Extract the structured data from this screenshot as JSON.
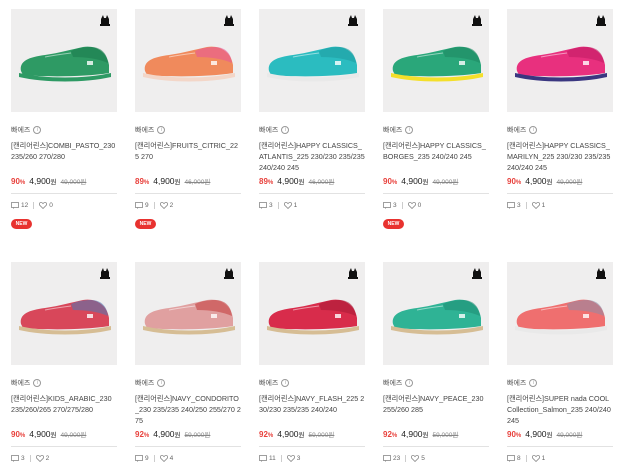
{
  "products": [
    {
      "brand": "빠에즈",
      "title": "[캔리어린스]COMBI_PASTO_230 235/260 270/280",
      "rate": "90",
      "price": "4,900",
      "orig": "49,000원",
      "comments": "12",
      "likes": "0",
      "badge": "NEW",
      "colors": {
        "upper": "#2e9a64",
        "sole": "#2e9a64",
        "trim": "#1c7a4d"
      }
    },
    {
      "brand": "빠에즈",
      "title": "[캔리어린스]FRUITS_CITRIC_225 270",
      "rate": "89",
      "price": "4,900",
      "orig": "46,000원",
      "comments": "9",
      "likes": "2",
      "badge": "NEW",
      "colors": {
        "upper": "#f08a5c",
        "sole": "#f3d6c8",
        "trim": "#e8559a"
      }
    },
    {
      "brand": "빠에즈",
      "title": "[캔리어린스]HAPPY CLASSICS_ATLANTIS_225 230/230 235/235 240/240 245",
      "rate": "89",
      "price": "4,900",
      "orig": "46,000원",
      "comments": "3",
      "likes": "1",
      "badge": "",
      "colors": {
        "upper": "#2bbcc0",
        "sole": "#e9e9e9",
        "trim": "#1f9a9e"
      }
    },
    {
      "brand": "빠에즈",
      "title": "[캔리어린스]HAPPY CLASSICS_BORGES_235 240/240 245",
      "rate": "90",
      "price": "4,900",
      "orig": "49,000원",
      "comments": "3",
      "likes": "0",
      "badge": "NEW",
      "colors": {
        "upper": "#2aa77a",
        "sole": "#f4df2a",
        "trim": "#1d8760"
      }
    },
    {
      "brand": "빠에즈",
      "title": "[캔리어린스]HAPPY CLASSICS_MARILYN_225 230/230 235/235 240/240 245",
      "rate": "90",
      "price": "4,900",
      "orig": "49,000원",
      "comments": "3",
      "likes": "1",
      "badge": "",
      "colors": {
        "upper": "#e8307e",
        "sole": "#3a3680",
        "trim": "#c01c63"
      }
    },
    {
      "brand": "빠에즈",
      "title": "[캔리어린스]KIDS_ARABIC_230 235/260/265 270/275/280",
      "rate": "90",
      "price": "4,900",
      "orig": "49,000원",
      "comments": "3",
      "likes": "2",
      "badge": "",
      "colors": {
        "upper": "#d8475a",
        "sole": "#d6bd94",
        "trim": "#4f78b5"
      }
    },
    {
      "brand": "빠에즈",
      "title": "[캔리어린스]NAVY_CONDORITO_230 235/235 240/250 255/270 275",
      "rate": "92",
      "price": "4,900",
      "orig": "59,000원",
      "comments": "9",
      "likes": "4",
      "badge": "",
      "colors": {
        "upper": "#e0a0a0",
        "sole": "#d6bd94",
        "trim": "#c23a3a"
      }
    },
    {
      "brand": "빠에즈",
      "title": "[캔리어린스]NAVY_FLASH_225 230/230 235/235 240/240",
      "rate": "92",
      "price": "4,900",
      "orig": "59,000원",
      "comments": "11",
      "likes": "3",
      "badge": "",
      "colors": {
        "upper": "#d82c4b",
        "sole": "#d6bd94",
        "trim": "#a81c36"
      }
    },
    {
      "brand": "빠에즈",
      "title": "[캔리어린스]NAVY_PEACE_230 255/260 285",
      "rate": "92",
      "price": "4,900",
      "orig": "59,000원",
      "comments": "23",
      "likes": "5",
      "badge": "",
      "colors": {
        "upper": "#2fb395",
        "sole": "#d6bd94",
        "trim": "#1f8c73"
      }
    },
    {
      "brand": "빠에즈",
      "title": "[캔리어린스]SUPER nada COOL Collection_Salmon_235 240/240 245",
      "rate": "90",
      "price": "4,900",
      "orig": "49,000원",
      "comments": "8",
      "likes": "1",
      "badge": "",
      "colors": {
        "upper": "#ef6f6f",
        "sole": "#e9e9e9",
        "trim": "#8c8ca8"
      }
    }
  ],
  "currency": "원",
  "percent": "%"
}
